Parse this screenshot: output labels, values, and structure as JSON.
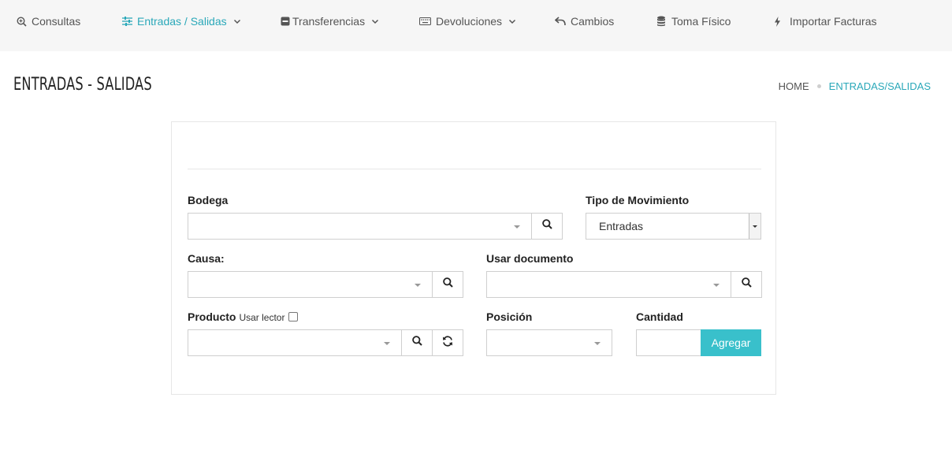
{
  "nav": {
    "items": [
      {
        "label": "Consultas",
        "icon": "search-plus-icon"
      },
      {
        "label": "Entradas / Salidas",
        "icon": "sliders-icon",
        "active": true
      },
      {
        "label": "Transferencias",
        "icon": "minus-square-icon"
      },
      {
        "label": "Devoluciones",
        "icon": "keyboard-icon"
      },
      {
        "label": "Cambios",
        "icon": "undo-icon"
      },
      {
        "label": "Toma Físico",
        "icon": "database-icon"
      },
      {
        "label": "Importar Facturas",
        "icon": "bolt-icon"
      }
    ]
  },
  "header": {
    "title": "ENTRADAS - SALIDAS",
    "breadcrumb": {
      "home": "HOME",
      "current": "ENTRADAS/SALIDAS"
    }
  },
  "form": {
    "bodega_label": "Bodega",
    "tipo_label": "Tipo de Movimiento",
    "tipo_value": "Entradas",
    "causa_label": "Causa:",
    "documento_label": "Usar documento",
    "producto_label": "Producto",
    "lector_label": "Usar lector",
    "posicion_label": "Posición",
    "cantidad_label": "Cantidad",
    "agregar_label": "Agregar"
  },
  "colors": {
    "accent": "#2aa8b9",
    "button": "#39c0cb",
    "nav_bg": "#f6f6f6"
  }
}
